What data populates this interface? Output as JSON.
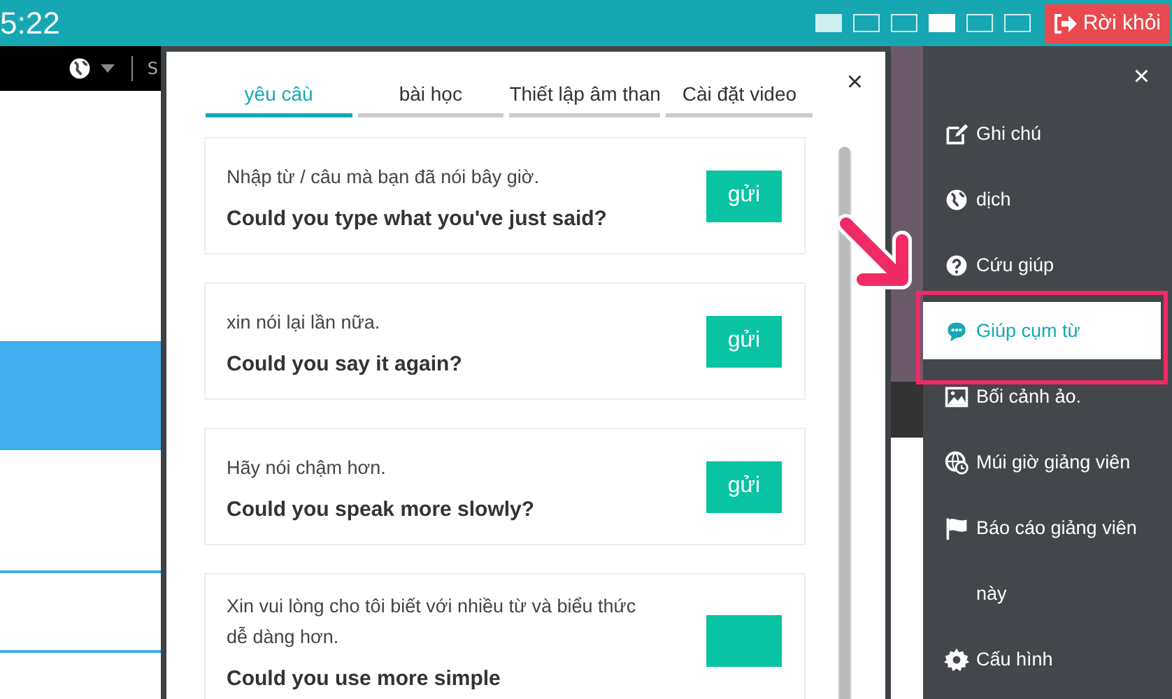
{
  "top_bar": {
    "time": "5:22",
    "layouts": [
      {
        "selected": false
      },
      {
        "selected": false
      },
      {
        "selected": false
      },
      {
        "selected": true
      },
      {
        "selected": false
      },
      {
        "selected": false
      }
    ],
    "leave_button": "Rời khỏi"
  },
  "background": {
    "nav_text": "S",
    "highlight_row": true
  },
  "modal": {
    "tabs": [
      {
        "label": "yêu câù",
        "selected": true
      },
      {
        "label": "bài học",
        "selected": false
      },
      {
        "label": "Thiết lập âm than",
        "selected": false
      },
      {
        "label": "Cài đặt video",
        "selected": false
      }
    ],
    "close": "×",
    "cards": [
      {
        "prompt": "Nhập từ / câu mà bạn đã nói bây giờ.",
        "phrase": "Could you type what you've just said?",
        "button": "gửi"
      },
      {
        "prompt": "xin nói lại lần nữa.",
        "phrase": "Could you say it again?",
        "button": "gửi"
      },
      {
        "prompt": "Hãy nói chậm hơn.",
        "phrase": "Could you speak more slowly?",
        "button": "gửi"
      },
      {
        "prompt": "Xin vui lòng cho tôi biết với nhiều từ và biểu thức dễ dàng hơn.",
        "phrase": "Could you use more simple"
      }
    ]
  },
  "sidebar": {
    "close": "×",
    "items": [
      {
        "label": "Ghi chú",
        "selected": false
      },
      {
        "label": "dịch",
        "selected": false
      },
      {
        "label": "Cứu giúp",
        "selected": false
      },
      {
        "label": "Giúp cụm từ",
        "selected": true
      },
      {
        "label": "Bối cảnh ảo.",
        "selected": false
      },
      {
        "label": "Múi giờ giảng viên",
        "selected": false
      },
      {
        "label": "Báo cáo giảng viên này",
        "selected": false
      },
      {
        "label": "Cấu hình",
        "selected": false
      }
    ]
  }
}
